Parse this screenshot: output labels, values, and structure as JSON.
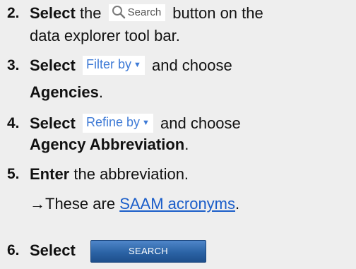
{
  "steps": [
    {
      "number": "2.",
      "verb": "Select",
      "mid": "button on the",
      "cont": "data explorer tool bar.",
      "chip": "Search",
      "chip_icon": "search-icon"
    },
    {
      "number": "3.",
      "verb": "Select",
      "chip": "Filter by",
      "after": "and choose",
      "cont": "Agencies",
      "cont_tail": "."
    },
    {
      "number": "4.",
      "verb": "Select",
      "chip": "Refine by",
      "after": "and choose",
      "cont": "Agency Abbreviation",
      "cont_tail": "."
    },
    {
      "number": "5.",
      "verb": "Enter",
      "after": "the abbreviation.",
      "note_arrow": "→",
      "note_text": "These are",
      "note_link": "SAAM acronyms",
      "note_tail": "."
    },
    {
      "number": "6.",
      "verb": "Select",
      "button": "SEARCH"
    }
  ],
  "colors": {
    "background": "#eeeeee",
    "chip_text": "#3f7bd6",
    "link": "#1a5dc9",
    "button": "#2b63a5"
  }
}
